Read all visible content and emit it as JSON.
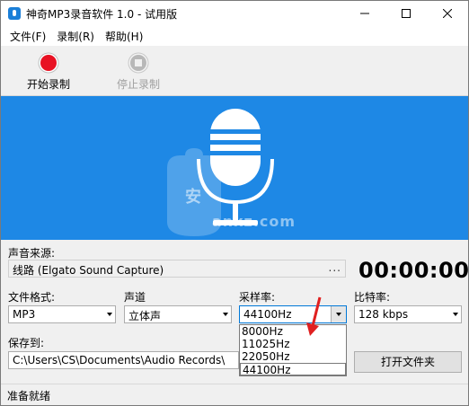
{
  "window": {
    "title": "神奇MP3录音软件 1.0 - 试用版"
  },
  "menu": [
    "文件(F)",
    "录制(R)",
    "帮助(H)"
  ],
  "toolbar": {
    "start_label": "开始录制",
    "stop_label": "停止录制"
  },
  "banner": {
    "watermark_domain": "anxz.com",
    "watermark_badge": "安"
  },
  "form": {
    "source_label": "声音来源:",
    "source_value": "线路 (Elgato Sound Capture)",
    "browse_dots": "...",
    "timer": "00:00:00",
    "format_label": "文件格式:",
    "format_value": "MP3",
    "channel_label": "声道",
    "channel_value": "立体声",
    "samplerate_label": "采样率:",
    "samplerate_value": "44100Hz",
    "samplerate_options": [
      "8000Hz",
      "11025Hz",
      "22050Hz",
      "44100Hz"
    ],
    "bitrate_label": "比特率:",
    "bitrate_value": "128 kbps",
    "saveto_label": "保存到:",
    "saveto_value": "C:\\Users\\CS\\Documents\\Audio Records\\",
    "open_folder_label": "打开文件夹"
  },
  "status": {
    "text": "准备就绪"
  },
  "colors": {
    "banner_blue": "#1e88e5",
    "record_red": "#e81123",
    "annotation_arrow": "#e02020"
  }
}
